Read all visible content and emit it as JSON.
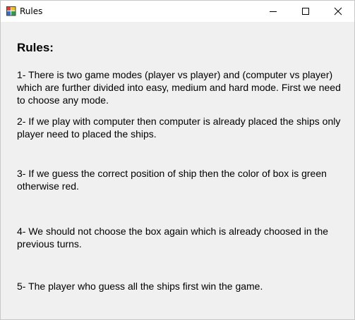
{
  "window": {
    "title": "Rules",
    "icon": "app-icon",
    "controls": [
      "minimize-icon",
      "maximize-icon",
      "close-icon"
    ]
  },
  "content": {
    "heading": "Rules:",
    "rules": [
      "1- There is two game modes (player vs player) and (computer vs player) which are further divided into easy, medium and hard mode. First we need to choose any mode.",
      "2- If we play with computer then computer is already placed the ships only player need to placed the ships.",
      "3- If we guess the correct position of ship then the color of box is green otherwise red.",
      "4- We should not choose the box again which is already choosed in the previous turns.",
      "5- The player who guess all the ships first win the game."
    ]
  }
}
